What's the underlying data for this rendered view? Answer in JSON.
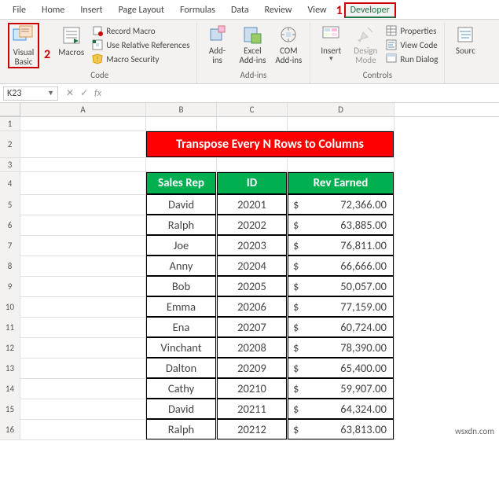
{
  "tabs": [
    "File",
    "Home",
    "Insert",
    "Page Layout",
    "Formulas",
    "Data",
    "Review",
    "View",
    "Developer"
  ],
  "activeTab": "Developer",
  "annotations": {
    "one": "1",
    "two": "2"
  },
  "ribbon": {
    "visualBasic": "Visual\nBasic",
    "macros": "Macros",
    "recordMacro": "Record Macro",
    "useRel": "Use Relative References",
    "macroSec": "Macro Security",
    "addins": "Add-\nins",
    "excelAddins": "Excel\nAdd-ins",
    "comAddins": "COM\nAdd-ins",
    "insert": "Insert",
    "design": "Design\nMode",
    "properties": "Properties",
    "viewCode": "View Code",
    "runDialog": "Run Dialog",
    "source": "Sourc",
    "grpCode": "Code",
    "grpAddins": "Add-ins",
    "grpControls": "Controls"
  },
  "namebox": "K23",
  "cols": [
    "A",
    "B",
    "C",
    "D"
  ],
  "title": "Transpose Every N Rows to Columns",
  "headers": {
    "rep": "Sales Rep",
    "id": "ID",
    "rev": "Rev Earned"
  },
  "rows": [
    {
      "n": "5",
      "rep": "David",
      "id": "20201",
      "cur": "$",
      "amt": "72,366.00"
    },
    {
      "n": "6",
      "rep": "Ralph",
      "id": "20202",
      "cur": "$",
      "amt": "63,885.00"
    },
    {
      "n": "7",
      "rep": "Joe",
      "id": "20203",
      "cur": "$",
      "amt": "76,811.00"
    },
    {
      "n": "8",
      "rep": "Anny",
      "id": "20204",
      "cur": "$",
      "amt": "66,666.00"
    },
    {
      "n": "9",
      "rep": "Bob",
      "id": "20205",
      "cur": "$",
      "amt": "50,057.00"
    },
    {
      "n": "10",
      "rep": "Emma",
      "id": "20206",
      "cur": "$",
      "amt": "77,159.00"
    },
    {
      "n": "11",
      "rep": "Ena",
      "id": "20207",
      "cur": "$",
      "amt": "60,724.00"
    },
    {
      "n": "12",
      "rep": "Vinchant",
      "id": "20208",
      "cur": "$",
      "amt": "78,390.00"
    },
    {
      "n": "13",
      "rep": "Dalton",
      "id": "20209",
      "cur": "$",
      "amt": "65,400.00"
    },
    {
      "n": "14",
      "rep": "Cathy",
      "id": "20210",
      "cur": "$",
      "amt": "59,907.00"
    },
    {
      "n": "15",
      "rep": "David",
      "id": "20211",
      "cur": "$",
      "amt": "64,324.00"
    },
    {
      "n": "16",
      "rep": "Ralph",
      "id": "20212",
      "cur": "$",
      "amt": "63,813.00"
    }
  ],
  "fixedRows": {
    "r1": "1",
    "r2": "2",
    "r3": "3",
    "r4": "4"
  },
  "watermark": "wsxdn.com"
}
